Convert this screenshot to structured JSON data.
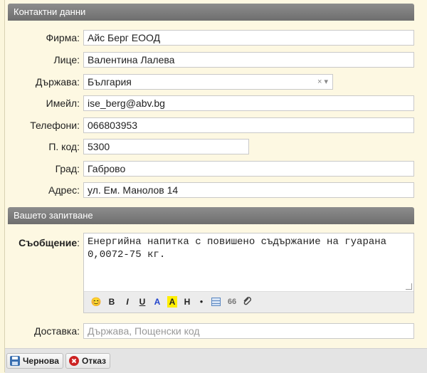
{
  "sections": {
    "contact": "Контактни данни",
    "inquiry": "Вашето запитване"
  },
  "contact": {
    "company_label": "Фирма:",
    "company_value": "Айс Берг ЕООД",
    "person_label": "Лице:",
    "person_value": "Валентина Лалева",
    "country_label": "Държава:",
    "country_value": "България",
    "email_label": "Имейл:",
    "email_value": "ise_berg@abv.bg",
    "phones_label": "Телефони:",
    "phones_value": "066803953",
    "zip_label": "П. код:",
    "zip_value": "5300",
    "city_label": "Град:",
    "city_value": "Габрово",
    "address_label": "Адрес:",
    "address_value": "ул. Ем. Манолов 14"
  },
  "inquiry": {
    "message_label": "Съобщение",
    "message_colon": ":",
    "message_value": "Енергийна напитка с повишено съдържание на гуарана 0,0072-75 кг.",
    "toolbar": {
      "emoji": "😊",
      "bold": "B",
      "italic": "I",
      "underline": "U",
      "color": "A",
      "highlight": "A",
      "heading": "H",
      "bullet": "●",
      "quote": "66"
    },
    "delivery_label": "Доставка:",
    "delivery_placeholder": "Държава, Пощенски код"
  },
  "buttons": {
    "draft": "Чернова",
    "cancel": "Отказ"
  },
  "colors": {
    "header_bg": "#7a7a7a",
    "highlight_yellow": "#ffee00",
    "color_blue": "#2244cc",
    "cancel_red": "#cc2222",
    "draft_blue": "#3a6fb0"
  }
}
